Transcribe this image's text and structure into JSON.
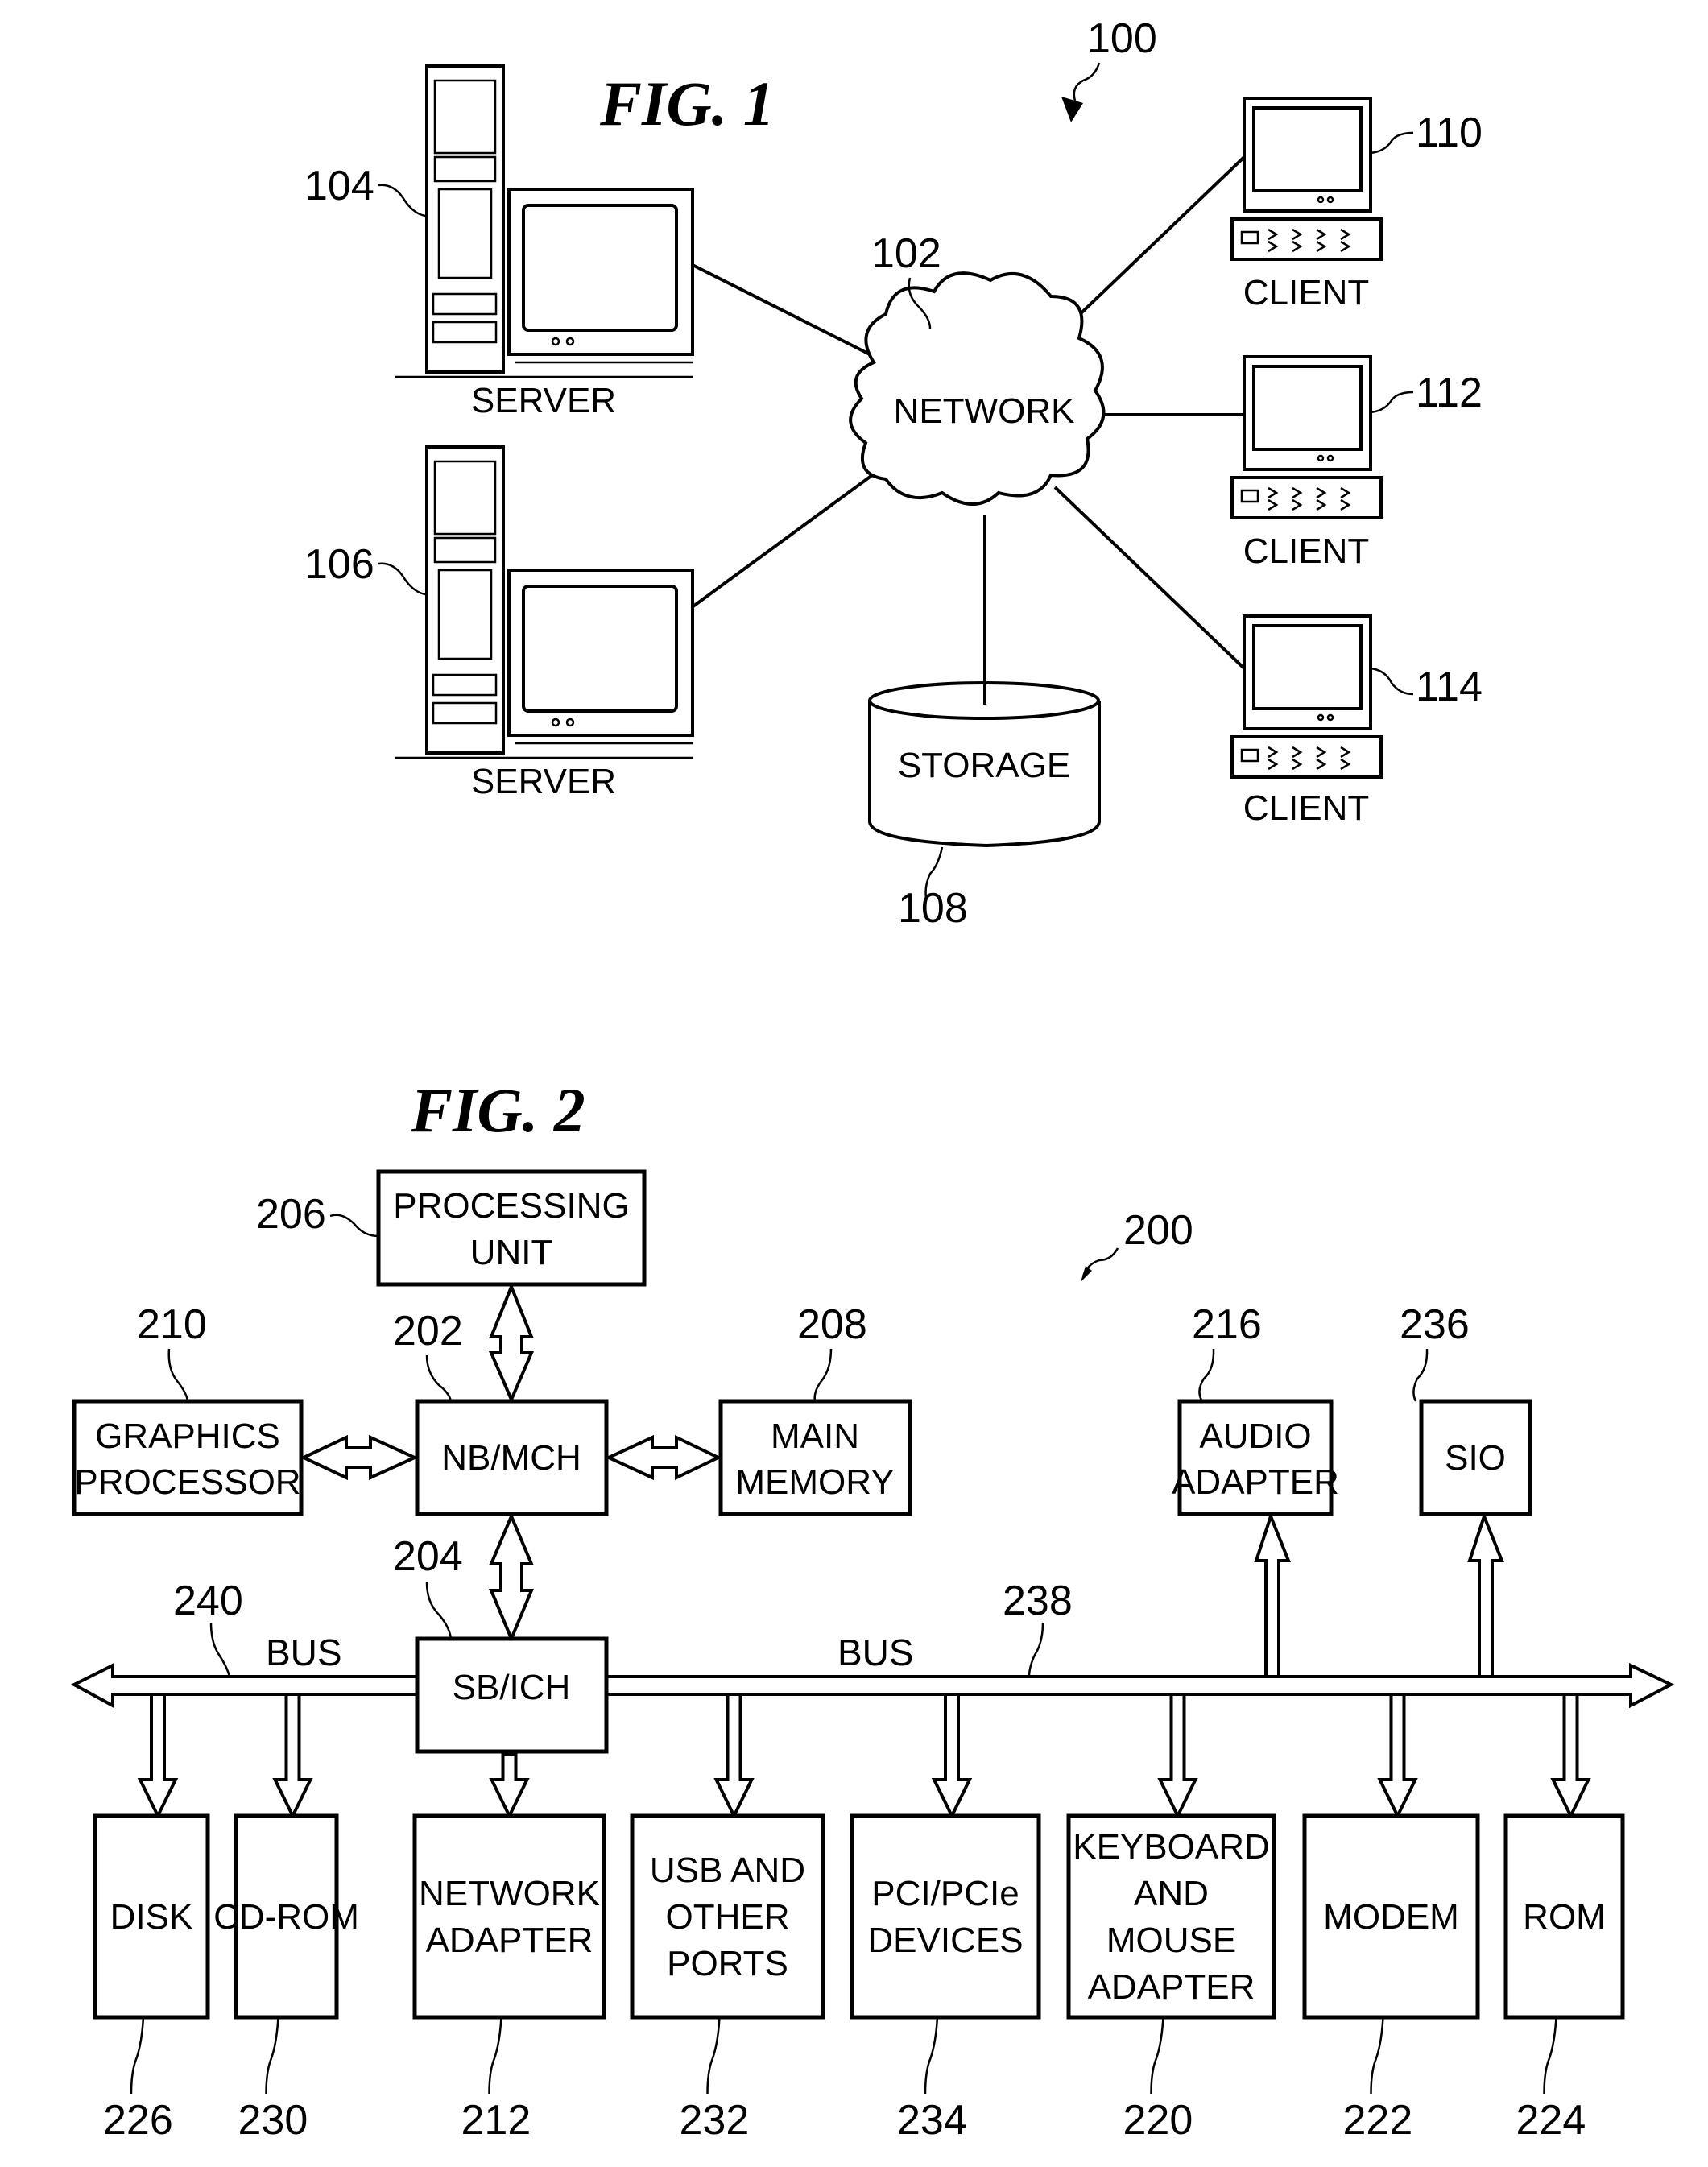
{
  "figure1": {
    "title": "FIG. 1",
    "ref": "100",
    "network": {
      "label": "NETWORK",
      "ref": "102"
    },
    "storage": {
      "label": "STORAGE",
      "ref": "108"
    },
    "servers": [
      {
        "label": "SERVER",
        "ref": "104"
      },
      {
        "label": "SERVER",
        "ref": "106"
      }
    ],
    "clients": [
      {
        "label": "CLIENT",
        "ref": "110"
      },
      {
        "label": "CLIENT",
        "ref": "112"
      },
      {
        "label": "CLIENT",
        "ref": "114"
      }
    ]
  },
  "figure2": {
    "title": "FIG. 2",
    "ref": "200",
    "processing_unit": {
      "lines": [
        "PROCESSING",
        "UNIT"
      ],
      "ref": "206"
    },
    "nb_mch": {
      "lines": [
        "NB/MCH"
      ],
      "ref": "202"
    },
    "graphics": {
      "lines": [
        "GRAPHICS",
        "PROCESSOR"
      ],
      "ref": "210"
    },
    "main_memory": {
      "lines": [
        "MAIN",
        "MEMORY"
      ],
      "ref": "208"
    },
    "sb_ich": {
      "lines": [
        "SB/ICH"
      ],
      "ref": "204"
    },
    "audio": {
      "lines": [
        "AUDIO",
        "ADAPTER"
      ],
      "ref": "216"
    },
    "sio": {
      "lines": [
        "SIO"
      ],
      "ref": "236"
    },
    "bus_left": {
      "label": "BUS",
      "ref": "240"
    },
    "bus_right": {
      "label": "BUS",
      "ref": "238"
    },
    "devices": [
      {
        "lines": [
          "DISK"
        ],
        "ref": "226"
      },
      {
        "lines": [
          "CD-ROM"
        ],
        "ref": "230"
      },
      {
        "lines": [
          "NETWORK",
          "ADAPTER"
        ],
        "ref": "212"
      },
      {
        "lines": [
          "USB AND",
          "OTHER",
          "PORTS"
        ],
        "ref": "232"
      },
      {
        "lines": [
          "PCI/PCIe",
          "DEVICES"
        ],
        "ref": "234"
      },
      {
        "lines": [
          "KEYBOARD",
          "AND",
          "MOUSE",
          "ADAPTER"
        ],
        "ref": "220"
      },
      {
        "lines": [
          "MODEM"
        ],
        "ref": "222"
      },
      {
        "lines": [
          "ROM"
        ],
        "ref": "224"
      }
    ]
  }
}
